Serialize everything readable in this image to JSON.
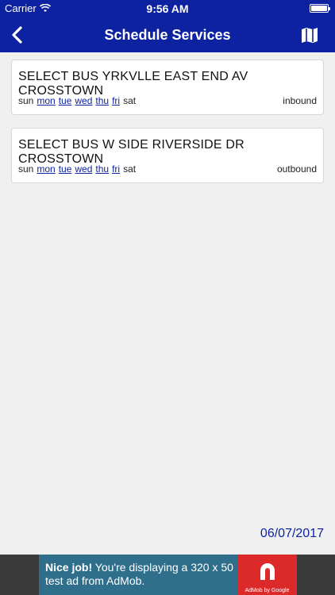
{
  "status_bar": {
    "carrier": "Carrier",
    "time": "9:56 AM"
  },
  "nav": {
    "title": "Schedule Services"
  },
  "services": [
    {
      "title": "SELECT BUS YRKVLLE EAST END AV CROSSTOWN",
      "days": [
        {
          "label": "sun",
          "active": false
        },
        {
          "label": "mon",
          "active": true
        },
        {
          "label": "tue",
          "active": true
        },
        {
          "label": "wed",
          "active": true
        },
        {
          "label": "thu",
          "active": true
        },
        {
          "label": "fri",
          "active": true
        },
        {
          "label": "sat",
          "active": false
        }
      ],
      "direction": "inbound"
    },
    {
      "title": "SELECT BUS W SIDE RIVERSIDE DR CROSSTOWN",
      "days": [
        {
          "label": "sun",
          "active": false
        },
        {
          "label": "mon",
          "active": true
        },
        {
          "label": "tue",
          "active": true
        },
        {
          "label": "wed",
          "active": true
        },
        {
          "label": "thu",
          "active": true
        },
        {
          "label": "fri",
          "active": true
        },
        {
          "label": "sat",
          "active": false
        }
      ],
      "direction": "outbound"
    }
  ],
  "date": "06/07/2017",
  "ad": {
    "headline": "Nice job!",
    "body": "You're displaying a 320 x 50 test ad from AdMob.",
    "logo_caption": "AdMob by Google"
  },
  "colors": {
    "header": "#0d22a0",
    "accent": "#0d22a0",
    "ad_logo": "#dc2a2a"
  }
}
